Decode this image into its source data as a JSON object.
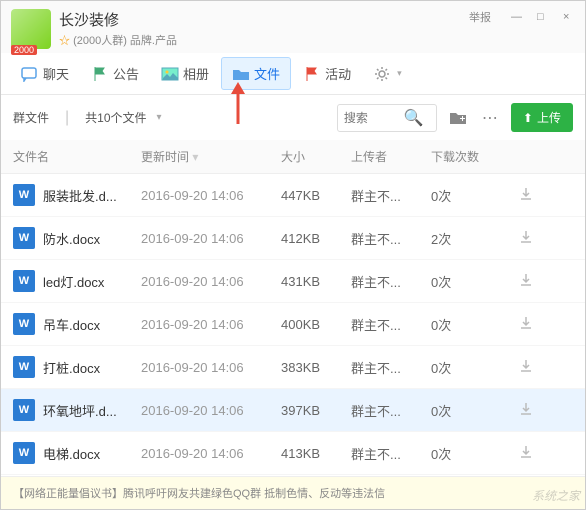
{
  "header": {
    "group_name": "长沙装修",
    "avatar_badge": "2000",
    "meta_star": "☆",
    "meta_text": "(2000人群) 品牌.产品",
    "report": "举报",
    "min": "—",
    "max": "□",
    "close": "×"
  },
  "tabs": [
    {
      "icon": "chat",
      "label": "聊天"
    },
    {
      "icon": "flag",
      "label": "公告"
    },
    {
      "icon": "image",
      "label": "相册"
    },
    {
      "icon": "folder",
      "label": "文件",
      "active": true
    },
    {
      "icon": "flag-red",
      "label": "活动"
    },
    {
      "icon": "gear",
      "label": ""
    }
  ],
  "toolbar": {
    "crumb1": "群文件",
    "crumb2": "共10个文件",
    "search_placeholder": "搜索",
    "upload_label": "上传"
  },
  "columns": {
    "name": "文件名",
    "time": "更新时间",
    "size": "大小",
    "uploader": "上传者",
    "downloads": "下载次数"
  },
  "files": [
    {
      "name": "服装批发.d...",
      "time": "2016-09-20 14:06",
      "size": "447KB",
      "uploader": "群主不...",
      "downloads": "0次"
    },
    {
      "name": "防水.docx",
      "time": "2016-09-20 14:06",
      "size": "412KB",
      "uploader": "群主不...",
      "downloads": "2次"
    },
    {
      "name": "led灯.docx",
      "time": "2016-09-20 14:06",
      "size": "431KB",
      "uploader": "群主不...",
      "downloads": "0次"
    },
    {
      "name": "吊车.docx",
      "time": "2016-09-20 14:06",
      "size": "400KB",
      "uploader": "群主不...",
      "downloads": "0次"
    },
    {
      "name": "打桩.docx",
      "time": "2016-09-20 14:06",
      "size": "383KB",
      "uploader": "群主不...",
      "downloads": "0次"
    },
    {
      "name": "环氧地坪.d...",
      "time": "2016-09-20 14:06",
      "size": "397KB",
      "uploader": "群主不...",
      "downloads": "0次",
      "selected": true
    },
    {
      "name": "电梯.docx",
      "time": "2016-09-20 14:06",
      "size": "413KB",
      "uploader": "群主不...",
      "downloads": "0次"
    }
  ],
  "footer": "【网络正能量倡议书】腾讯呼吁网友共建绿色QQ群 抵制色情、反动等违法信",
  "watermark": "系统之家"
}
